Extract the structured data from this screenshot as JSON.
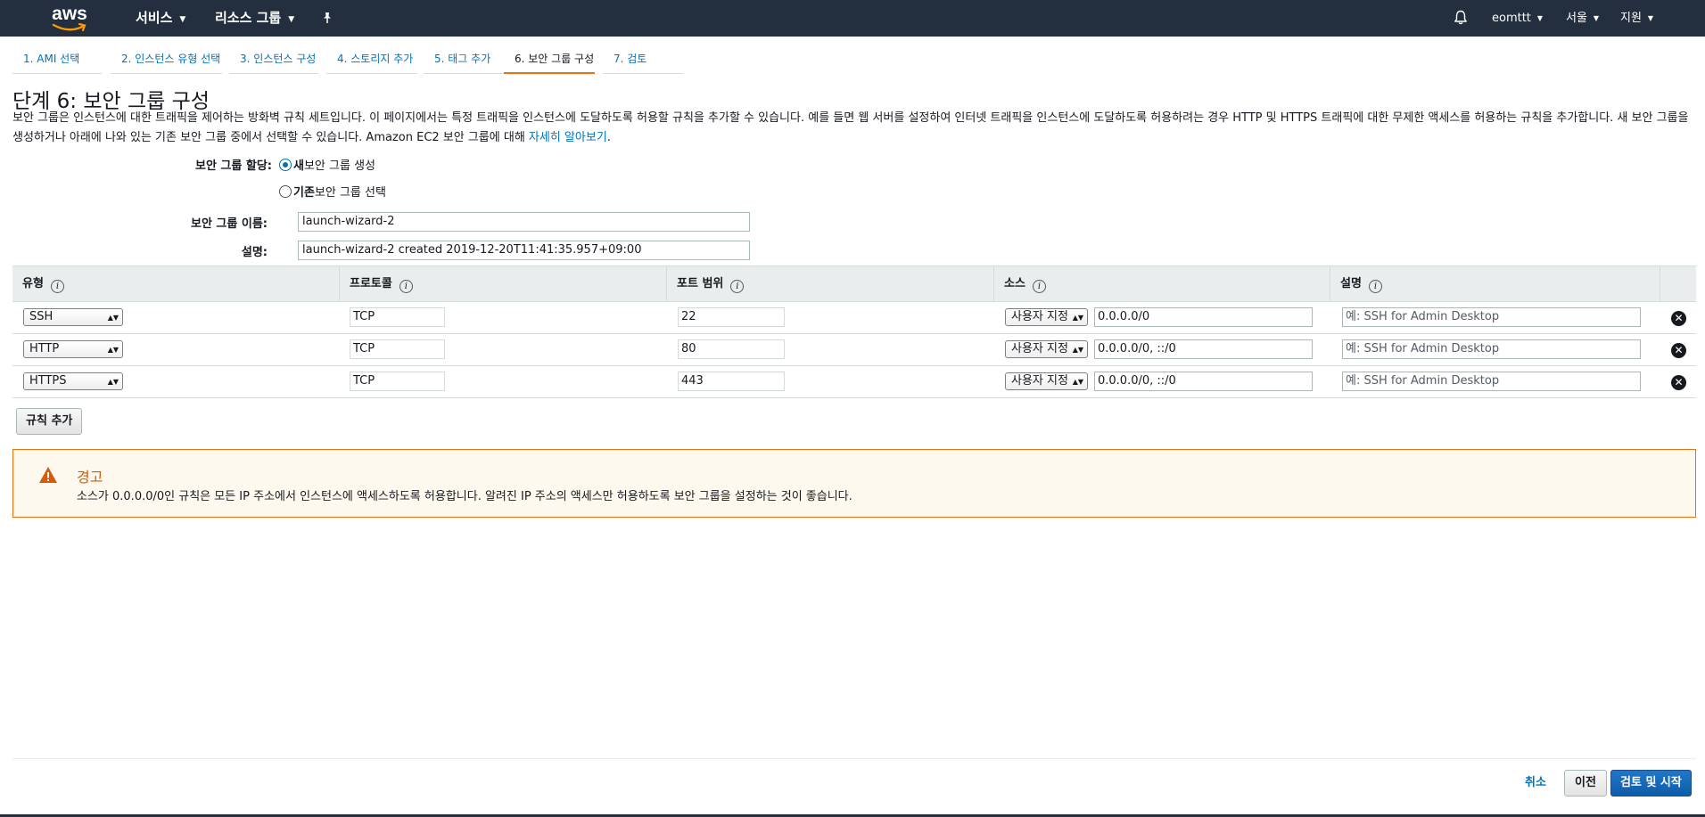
{
  "topbar": {
    "logo": "aws",
    "services": "서비스",
    "resource_groups": "리소스 그룹",
    "pin_icon": "pushpin-icon",
    "bell_icon": "bell-icon",
    "user": "eomttt",
    "region": "서울",
    "support": "지원"
  },
  "steps": [
    {
      "label": "1. AMI 선택"
    },
    {
      "label": "2. 인스턴스 유형 선택"
    },
    {
      "label": "3. 인스턴스 구성"
    },
    {
      "label": "4. 스토리지 추가"
    },
    {
      "label": "5. 태그 추가"
    },
    {
      "label": "6. 보안 그룹 구성"
    },
    {
      "label": "7. 검토"
    }
  ],
  "page": {
    "title": "단계 6: 보안 그룹 구성",
    "description": "보안 그룹은 인스턴스에 대한 트래픽을 제어하는 방화벽 규칙 세트입니다. 이 페이지에서는 특정 트래픽을 인스턴스에 도달하도록 허용할 규칙을 추가할 수 있습니다. 예를 들면 웹 서버를 설정하여 인터넷 트래픽을 인스턴스에 도달하도록 허용하려는 경우 HTTP 및 HTTPS 트래픽에 대한 무제한 액세스를 허용하는 규칙을 추가합니다. 새 보안 그룹을 생성하거나 아래에 나와 있는 기존 보안 그룹 중에서 선택할 수 있습니다. Amazon EC2 보안 그룹에 대해",
    "learn_more": "자세히 알아보기",
    "period": "."
  },
  "form": {
    "assign_label": "보안 그룹 할당:",
    "option_new_bold": "새",
    "option_new_rest": " 보안 그룹 생성",
    "option_existing_bold": "기존",
    "option_existing_rest": " 보안 그룹 선택",
    "name_label": "보안 그룹 이름:",
    "name_value": "launch-wizard-2",
    "desc_label": "설명:",
    "desc_value": "launch-wizard-2 created 2019-12-20T11:41:35.957+09:00"
  },
  "table": {
    "headers": {
      "type": "유형",
      "protocol": "프로토콜",
      "port_range": "포트 범위",
      "source": "소스",
      "description": "설명"
    },
    "rows": [
      {
        "type": "SSH",
        "protocol": "TCP",
        "port": "22",
        "source_mode": "사용자 지정",
        "source": "0.0.0.0/0",
        "desc_placeholder": "예: SSH for Admin Desktop"
      },
      {
        "type": "HTTP",
        "protocol": "TCP",
        "port": "80",
        "source_mode": "사용자 지정",
        "source": "0.0.0.0/0, ::/0",
        "desc_placeholder": "예: SSH for Admin Desktop"
      },
      {
        "type": "HTTPS",
        "protocol": "TCP",
        "port": "443",
        "source_mode": "사용자 지정",
        "source": "0.0.0.0/0, ::/0",
        "desc_placeholder": "예: SSH for Admin Desktop"
      }
    ],
    "add_rule": "규칙 추가"
  },
  "warning": {
    "title": "경고",
    "text": "소스가 0.0.0.0/0인 규칙은 모든 IP 주소에서 인스턴스에 액세스하도록 허용합니다. 알려진 IP 주소의 액세스만 허용하도록 보안 그룹을 설정하는 것이 좋습니다."
  },
  "footer": {
    "cancel": "취소",
    "previous": "이전",
    "review_launch": "검토 및 시작"
  },
  "colors": {
    "nav_bg": "#232f3e",
    "accent_orange": "#ec7211",
    "link_blue": "#0073bb",
    "primary_button": "#1f77c9",
    "warning_text": "#d45b07"
  }
}
